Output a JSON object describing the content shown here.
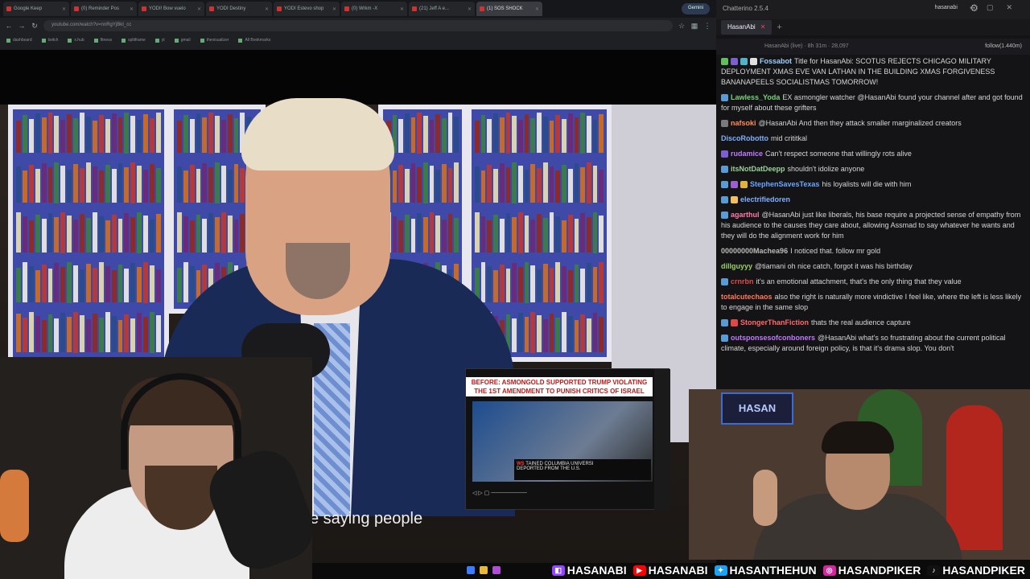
{
  "browser": {
    "tabs": [
      {
        "label": "Google Keep",
        "active": false
      },
      {
        "label": "(0) Reminder Pos",
        "active": false
      },
      {
        "label": "YODI! Bow vuelo",
        "active": false
      },
      {
        "label": "YODI Destiny",
        "active": false
      },
      {
        "label": "YODI Estevo shop",
        "active": false
      },
      {
        "label": "(0) Wrkm -X",
        "active": false
      },
      {
        "label": "(21) Jeff A e...",
        "active": false
      },
      {
        "label": "(1) SOS SHOCK",
        "active": true
      }
    ],
    "gemini_label": "Gemini",
    "url": "youtube.com/watch?v=nnRgYjBkI_cc",
    "bookmarks": [
      "dashboard",
      "twitch",
      "x.hub",
      "fitness",
      "splitframe",
      "yt",
      "gmail",
      "thevisualizer",
      "All Bookmarks"
    ]
  },
  "video": {
    "subtitle": "e saying people",
    "thumbnail": {
      "headline": "BEFORE: ASMONGOLD SUPPORTED TRUMP VIOLATING THE 1ST AMENDMENT TO PUNISH CRITICS OF ISRAEL",
      "lower_third_prefix": "WS",
      "lower_third": "TAINED COLUMBIA UNIVERSI",
      "lower_third_2": "DEPORTED FROM THE U.S.",
      "controls": "◁  ▷  ▢ ─────────"
    }
  },
  "chatterino": {
    "title": "Chatterino 2.5.4",
    "user": "hasanabi",
    "tab_label": "HasanAbi",
    "channel_header": "HasanAbi (live) · 8h 31m · 28,097",
    "follow_label": "follow(1.440m)",
    "messages": [
      {
        "user": "Fossabot",
        "user_color": "#9ad0ff",
        "badges": [
          "#5fbf5f",
          "#7a5fd1",
          "#4fb3c9",
          "#e0e0e0"
        ],
        "text": "Title for HasanAbi: SCOTUS REJECTS CHICAGO MILITARY DEPLOYMENT XMAS EVE VAN LATHAN IN THE BUILDING XMAS FORGIVENESS BANANAPEELS SOCIALISTMAS TOMORROW!"
      },
      {
        "user": "Lawless_Yoda",
        "user_color": "#79d279",
        "badges": [
          "#5a9bd6"
        ],
        "text": "EX asmongler watcher @HasanAbi found your channel after and got found for myself about these grifters"
      },
      {
        "user": "nafsoki",
        "user_color": "#ff8c5a",
        "badges": [
          "#7a7a7a"
        ],
        "text": "@HasanAbi And then they attack smaller marginalized creators"
      },
      {
        "user": "DiscoRobotto",
        "user_color": "#7fb0ff",
        "badges": [],
        "text": "mid crititkal"
      },
      {
        "user": "rudamice",
        "user_color": "#c07aff",
        "badges": [
          "#7a5fd1"
        ],
        "text": "Can't respect someone that willingly rots alive"
      },
      {
        "user": "itsNotDatDeepp",
        "user_color": "#9cd19c",
        "badges": [
          "#5a9bd6"
        ],
        "text": "shouldn't idolize anyone"
      },
      {
        "user": "StephenSavesTexas",
        "user_color": "#6aa6ff",
        "badges": [
          "#5a9bd6",
          "#9c5fd1",
          "#e0b13c"
        ],
        "text": "his loyalists will die with him"
      },
      {
        "user": "electrifiedoren",
        "user_color": "#7fb0ff",
        "badges": [
          "#5a9bd6",
          "#f0c060"
        ],
        "text": ""
      },
      {
        "user": "agarthul",
        "user_color": "#ff7aa8",
        "badges": [
          "#5a9bd6"
        ],
        "text": "@HasanAbi just like liberals, his base require a projected sense of empathy from his audience to the causes they care about, allowing Assmad to say whatever he wants and they will do the alignment work for him"
      },
      {
        "user": "00000000Machea96",
        "user_color": "#bbbbbb",
        "badges": [],
        "text": "I noticed that. follow mr gold"
      },
      {
        "user": "dillguyyy",
        "user_color": "#9ad06a",
        "badges": [],
        "text": "@tiamani oh nice catch, forgot it was his birthday"
      },
      {
        "user": "crnrbn",
        "user_color": "#e04848",
        "badges": [
          "#5a9bd6"
        ],
        "text": "it's an emotional attachment, that's the only thing that they value"
      },
      {
        "user": "totalcutechaos",
        "user_color": "#ff7a5a",
        "badges": [],
        "text": "also the right is naturally more vindictive I feel like, where the left is less likely to engage in the same slop"
      },
      {
        "user": "StongerThanFiction",
        "user_color": "#ff6a6a",
        "badges": [
          "#5a9bd6",
          "#e04848"
        ],
        "text": "thats the real audience capture"
      },
      {
        "user": "outsponsesofconboners",
        "user_color": "#c07aff",
        "badges": [
          "#5a9bd6"
        ],
        "text": "@HasanAbi what's so frustrating about the current political climate, especially around foreign policy, is that it's drama slop. You don't"
      }
    ]
  },
  "hasan_cam": {
    "logo_text": "HASAN"
  },
  "social_bar": [
    {
      "platform": "twitch",
      "icon_color": "#9146ff",
      "glyph": "◧",
      "handle": "HASANABI"
    },
    {
      "platform": "youtube",
      "icon_color": "#ff0000",
      "glyph": "▶",
      "handle": "HASANABI"
    },
    {
      "platform": "twitter",
      "icon_color": "#1da1f2",
      "glyph": "✦",
      "handle": "HASANTHEHUN"
    },
    {
      "platform": "instagram",
      "icon_color": "#d6249f",
      "glyph": "◎",
      "handle": "HASANDPIKER"
    },
    {
      "platform": "tiktok",
      "icon_color": "#111111",
      "glyph": "♪",
      "handle": "HASANDPIKER"
    }
  ]
}
